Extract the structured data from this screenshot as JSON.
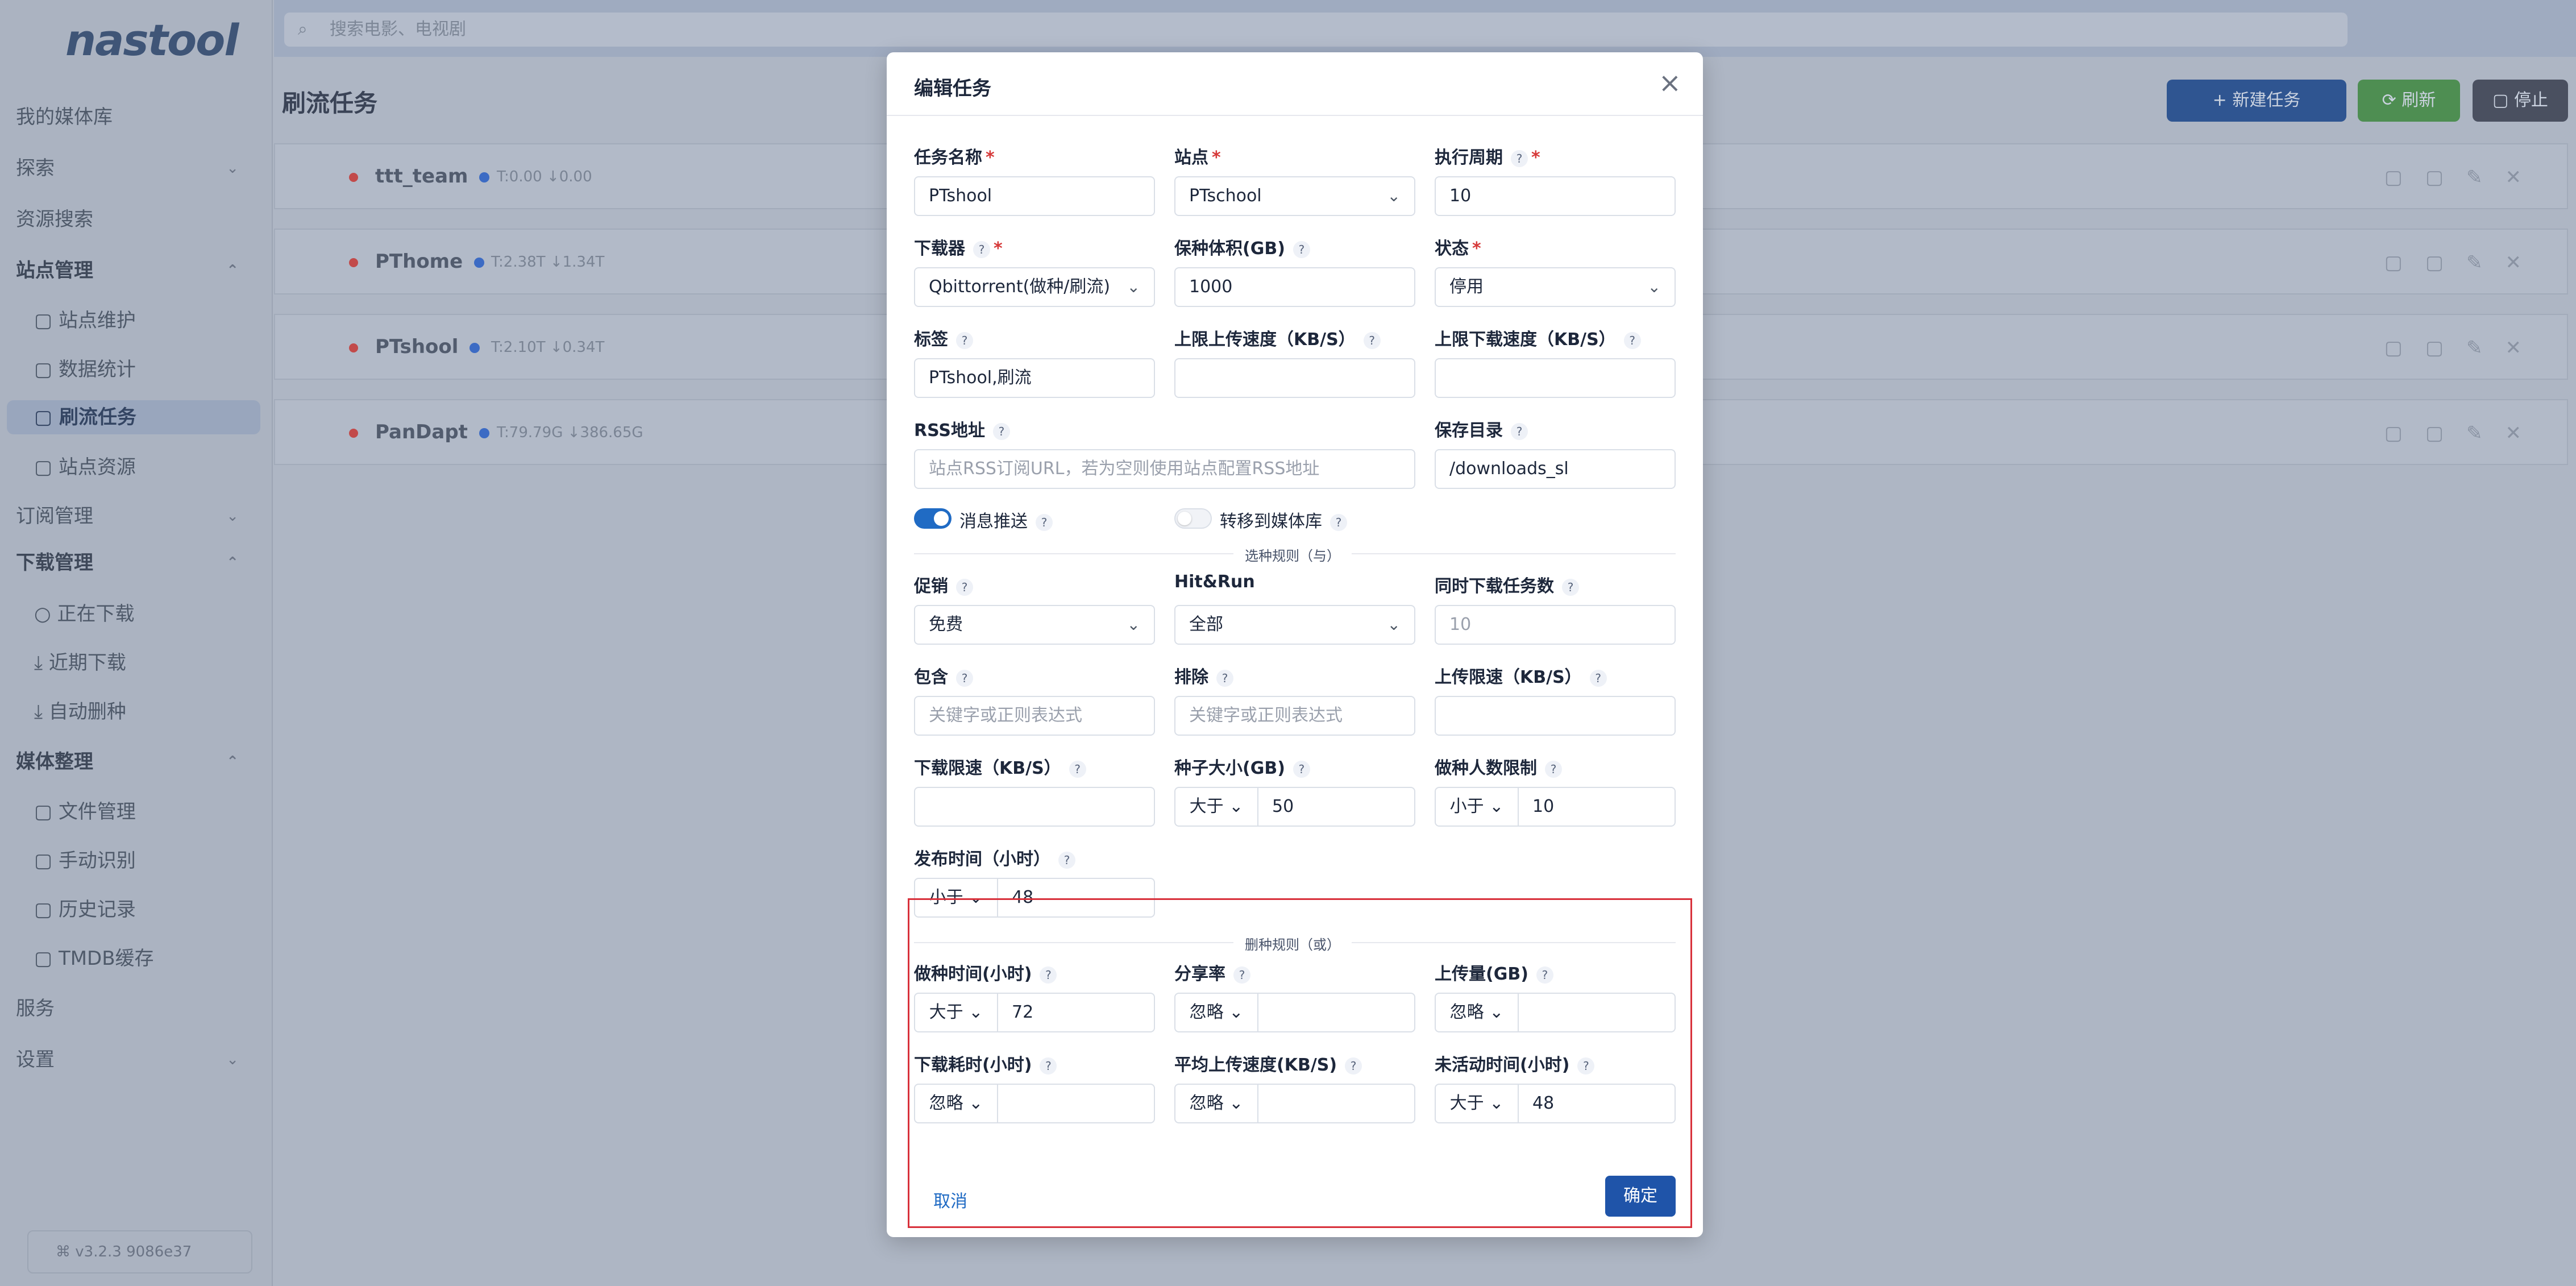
{
  "app": {
    "logo": "nastool",
    "version": "v3.2.3 9086e37"
  },
  "sidebar": {
    "items": [
      {
        "label": "我的媒体库"
      },
      {
        "label": "探索"
      },
      {
        "label": "资源搜索"
      },
      {
        "label": "站点管理"
      },
      {
        "label": "站点维护"
      },
      {
        "label": "数据统计"
      },
      {
        "label": "刷流任务"
      },
      {
        "label": "站点资源"
      },
      {
        "label": "订阅管理"
      },
      {
        "label": "下载管理"
      },
      {
        "label": "正在下载"
      },
      {
        "label": "近期下载"
      },
      {
        "label": "自动删种"
      },
      {
        "label": "媒体整理"
      },
      {
        "label": "文件管理"
      },
      {
        "label": "手动识别"
      },
      {
        "label": "历史记录"
      },
      {
        "label": "TMDB缓存"
      },
      {
        "label": "服务"
      },
      {
        "label": "设置"
      }
    ]
  },
  "topbar": {
    "search_placeholder": "搜索电影、电视剧"
  },
  "page": {
    "title": "刷流任务",
    "buttons": {
      "new": "新建任务",
      "refresh": "刷新",
      "stop": "停止"
    },
    "rows": [
      {
        "name": "ttt_team",
        "meta": "T:0.00 ↓0.00"
      },
      {
        "name": "PThome",
        "meta": "T:2.38T ↓1.34T"
      },
      {
        "name": "PTshool",
        "meta": "T:2.10T ↓0.34T"
      },
      {
        "name": "PanDapt",
        "meta": "T:79.79G ↓386.65G"
      }
    ]
  },
  "modal": {
    "title": "编辑任务",
    "fields": {
      "task_name": {
        "label": "任务名称",
        "value": "PTshool"
      },
      "site": {
        "label": "站点",
        "value": "PTschool"
      },
      "period": {
        "label": "执行周期",
        "value": "10"
      },
      "downloader": {
        "label": "下载器",
        "value": "Qbittorrent(做种/刷流)"
      },
      "keep_size": {
        "label": "保种体积(GB)",
        "value": "1000"
      },
      "status": {
        "label": "状态",
        "value": "停用"
      },
      "tags": {
        "label": "标签",
        "value": "PTshool,刷流"
      },
      "up_limit": {
        "label": "上限上传速度（KB/S）",
        "value": ""
      },
      "down_limit": {
        "label": "上限下载速度（KB/S）",
        "value": ""
      },
      "rss": {
        "label": "RSS地址",
        "placeholder": "站点RSS订阅URL，若为空则使用站点配置RSS地址"
      },
      "save_dir": {
        "label": "保存目录",
        "value": "/downloads_sl"
      },
      "msg_push": {
        "label": "消息推送",
        "on": true
      },
      "transfer": {
        "label": "转移到媒体库",
        "on": false
      }
    },
    "select_rules": {
      "title": "选种规则（与）",
      "promo": {
        "label": "促销",
        "value": "免费"
      },
      "hr": {
        "label": "Hit&Run",
        "value": "全部"
      },
      "concurrent": {
        "label": "同时下载任务数",
        "value": "10"
      },
      "include": {
        "label": "包含",
        "placeholder": "关键字或正则表达式"
      },
      "exclude": {
        "label": "排除",
        "placeholder": "关键字或正则表达式"
      },
      "upload_limit": {
        "label": "上传限速（KB/S）",
        "value": ""
      },
      "download_limit": {
        "label": "下载限速（KB/S）",
        "value": ""
      },
      "size": {
        "label": "种子大小(GB)",
        "op": "大于",
        "value": "50"
      },
      "seeders": {
        "label": "做种人数限制",
        "op": "小于",
        "value": "10"
      },
      "pubtime": {
        "label": "发布时间（小时）",
        "op": "小于",
        "value": "48"
      }
    },
    "delete_rules": {
      "title": "删种规则（或）",
      "seed_time": {
        "label": "做种时间(小时)",
        "op": "大于",
        "value": "72"
      },
      "ratio": {
        "label": "分享率",
        "op": "忽略",
        "value": ""
      },
      "uploaded": {
        "label": "上传量(GB)",
        "op": "忽略",
        "value": ""
      },
      "dl_time": {
        "label": "下载耗时(小时)",
        "op": "忽略",
        "value": ""
      },
      "avg_up": {
        "label": "平均上传速度(KB/S)",
        "op": "忽略",
        "value": ""
      },
      "idle": {
        "label": "未活动时间(小时)",
        "op": "大于",
        "value": "48"
      }
    },
    "cancel": "取消",
    "confirm": "确定"
  }
}
